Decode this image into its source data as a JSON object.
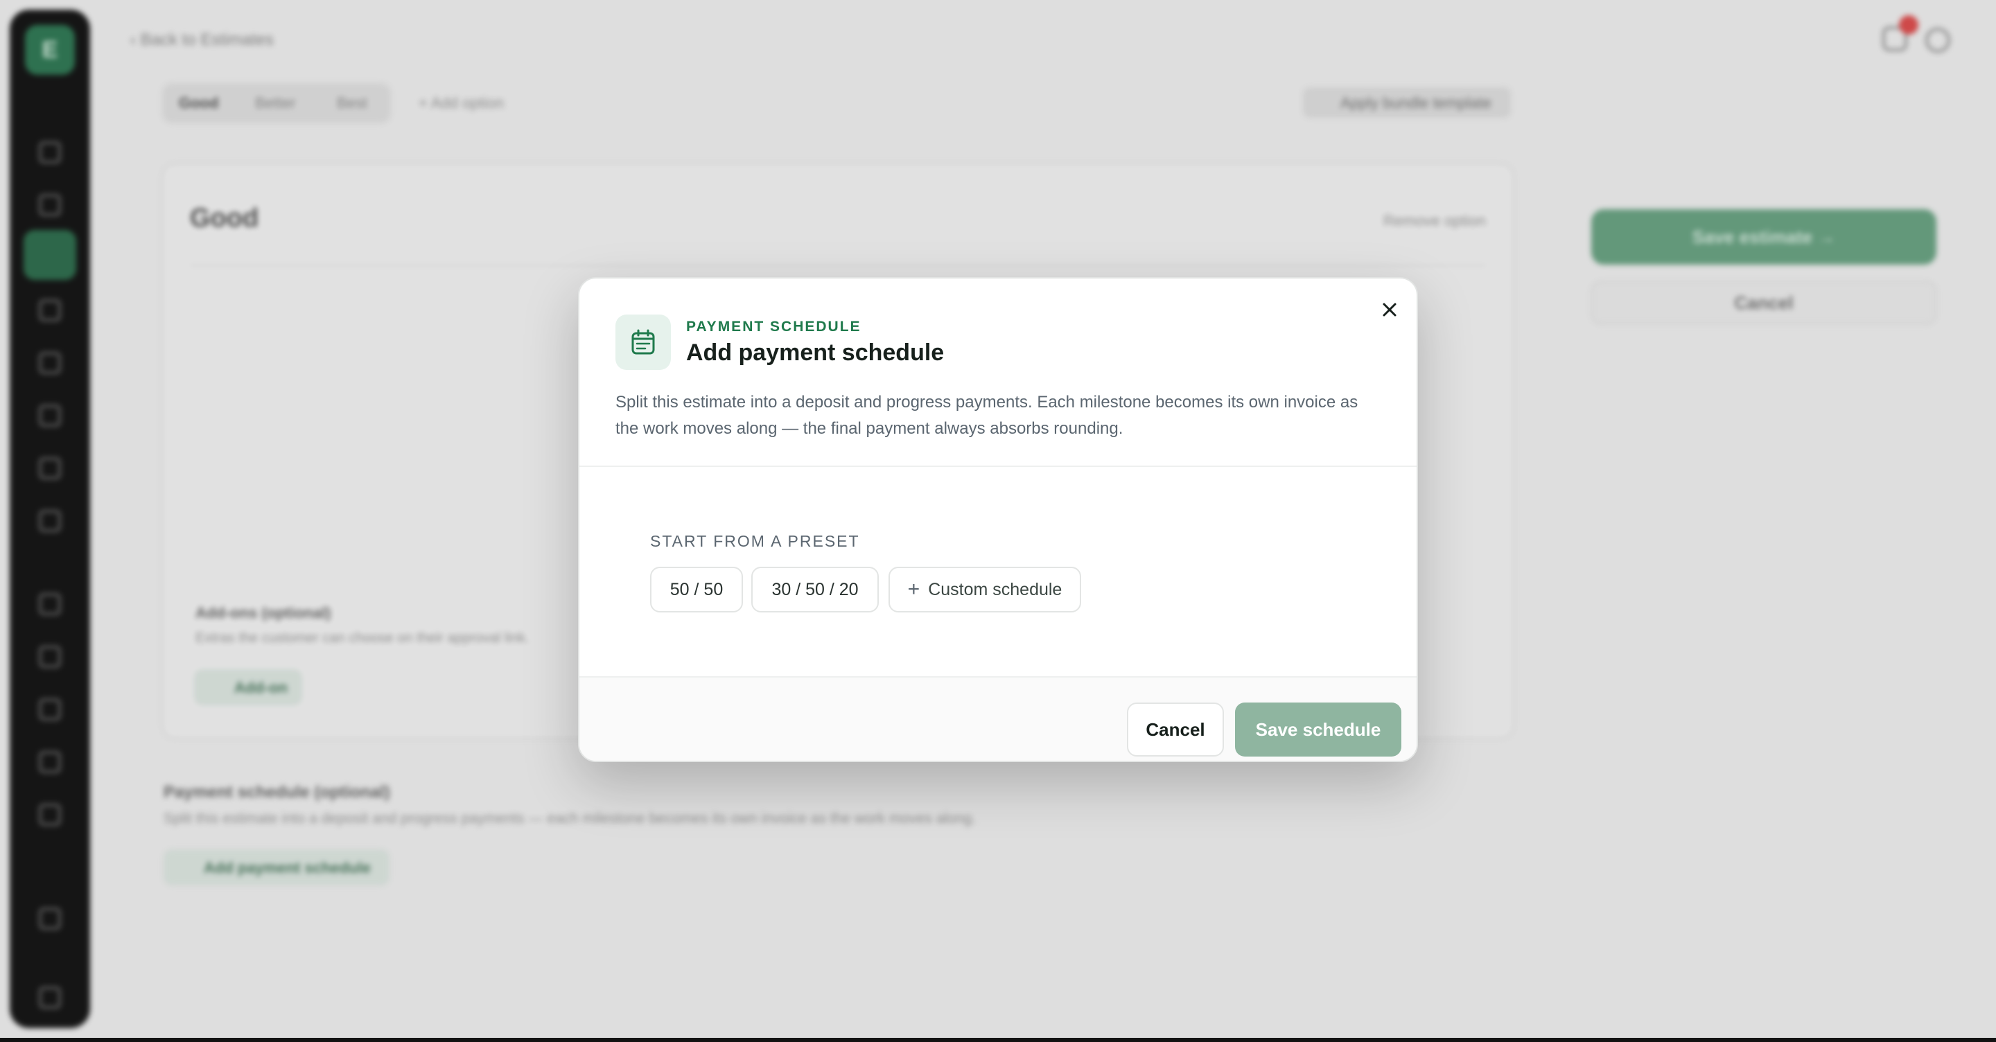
{
  "background": {
    "back_link": "‹  Back to Estimates",
    "tabs": [
      "Good",
      "Better",
      "Best"
    ],
    "add_option": "+  Add option",
    "apply_template": "Apply bundle template",
    "option_title": "Good",
    "remove_option": "Remove option",
    "addons_title": "Add-ons (optional)",
    "addons_subtitle": "Extras the customer can choose on their approval link.",
    "add_on_button": "Add-on",
    "payment_title": "Payment schedule (optional)",
    "payment_subtitle": "Split this estimate into a deposit and progress payments — each milestone becomes its own invoice as the work moves along.",
    "add_payment_button": "Add payment schedule",
    "save_estimate": "Save estimate  →",
    "cancel": "Cancel",
    "logo_letter": "E"
  },
  "modal": {
    "icon": "calendar-icon",
    "eyebrow": "PAYMENT SCHEDULE",
    "title": "Add payment schedule",
    "description": "Split this estimate into a deposit and progress payments. Each milestone becomes its own invoice as the work moves along — the final payment always absorbs rounding.",
    "preset_label": "START FROM A PRESET",
    "presets": [
      "50 / 50",
      "30 / 50 / 20"
    ],
    "custom_label": "Custom schedule",
    "cancel_label": "Cancel",
    "save_label": "Save schedule",
    "colors": {
      "accent": "#1f7a4c",
      "save_disabled": "#8fb5a0",
      "icon_bg": "#e6f2ec"
    }
  }
}
